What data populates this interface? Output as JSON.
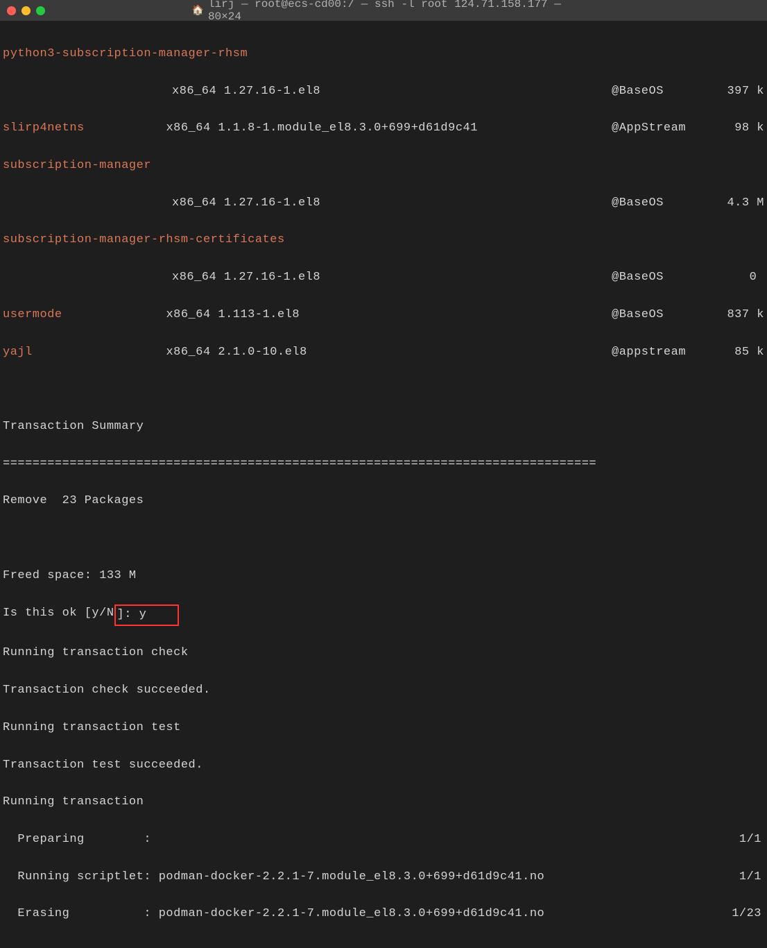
{
  "titlebar": {
    "title": "lirj — root@ecs-cd00:/ — ssh -l root 124.71.158.177 — 80×24"
  },
  "packages": [
    {
      "name": "python3-subscription-manager-rhsm",
      "arch": "x86_64",
      "version": "1.27.16-1.el8",
      "repo": "@BaseOS",
      "size": "397 k"
    },
    {
      "name": "slirp4netns",
      "arch": "x86_64",
      "version": "1.1.8-1.module_el8.3.0+699+d61d9c41",
      "repo": "@AppStream",
      "size": "98 k"
    },
    {
      "name": "subscription-manager",
      "arch": "x86_64",
      "version": "1.27.16-1.el8",
      "repo": "@BaseOS",
      "size": "4.3 M"
    },
    {
      "name": "subscription-manager-rhsm-certificates",
      "arch": "x86_64",
      "version": "1.27.16-1.el8",
      "repo": "@BaseOS",
      "size": "0 "
    },
    {
      "name": "usermode",
      "arch": "x86_64",
      "version": "1.113-1.el8",
      "repo": "@BaseOS",
      "size": "837 k"
    },
    {
      "name": "yajl",
      "arch": "x86_64",
      "version": "2.1.0-10.el8",
      "repo": "@appstream",
      "size": "85 k"
    }
  ],
  "summary": {
    "header": "Transaction Summary",
    "divider": "================================================================================",
    "remove": "Remove  23 Packages",
    "freed": "Freed space: 133 M",
    "prompt_label": "Is this ok [y/N",
    "prompt_answer": "]: y"
  },
  "transaction": {
    "check": "Running transaction check",
    "check_done": "Transaction check succeeded.",
    "test": "Running transaction test",
    "test_done": "Transaction test succeeded.",
    "running": "Running transaction",
    "preparing_label": "  Preparing        :",
    "preparing_progress": "1/1",
    "scriptlet_label": "  Running scriptlet: podman-docker-2.2.1-7.module_el8.3.0+699+d61d9c41.no",
    "scriptlet_progress": "1/1",
    "erasing_label": "  Erasing          : podman-docker-2.2.1-7.module_el8.3.0+699+d61d9c41.no",
    "erasing_progress": "1/23"
  }
}
